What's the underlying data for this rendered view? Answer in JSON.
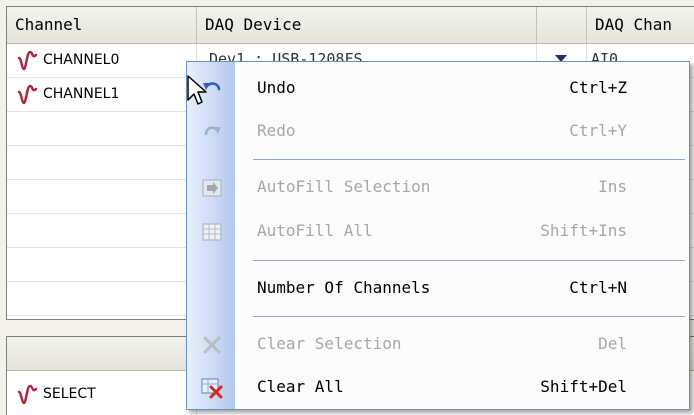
{
  "grid": {
    "columns": [
      "Channel",
      "DAQ Device",
      "",
      "DAQ Chan"
    ],
    "rows": [
      {
        "channel": "CHANNEL0",
        "device": "Dev1 : USB-1208FS",
        "daq_channel": "AI0"
      },
      {
        "channel": "CHANNEL1",
        "device": "",
        "daq_channel": ""
      }
    ]
  },
  "grid2": {
    "rows": [
      {
        "channel": "SELECT"
      }
    ]
  },
  "context_menu": {
    "items": [
      {
        "label": "Undo",
        "shortcut": "Ctrl+Z",
        "enabled": true,
        "icon": "undo-icon"
      },
      {
        "label": "Redo",
        "shortcut": "Ctrl+Y",
        "enabled": false,
        "icon": "redo-icon"
      },
      {
        "label": "AutoFill Selection",
        "shortcut": "Ins",
        "enabled": false,
        "icon": "autofill-selection-icon"
      },
      {
        "label": "AutoFill All",
        "shortcut": "Shift+Ins",
        "enabled": false,
        "icon": "autofill-all-icon"
      },
      {
        "label": "Number Of Channels",
        "shortcut": "Ctrl+N",
        "enabled": true,
        "icon": ""
      },
      {
        "label": "Clear Selection",
        "shortcut": "Del",
        "enabled": false,
        "icon": "clear-selection-icon"
      },
      {
        "label": "Clear All",
        "shortcut": "Shift+Del",
        "enabled": true,
        "icon": "clear-all-icon"
      }
    ]
  },
  "colors": {
    "menu_border": "#6d8fc4",
    "menu_strip": "#c9d8f4",
    "disabled_text": "#a7a7a7",
    "channel_icon": "#b0233a"
  }
}
